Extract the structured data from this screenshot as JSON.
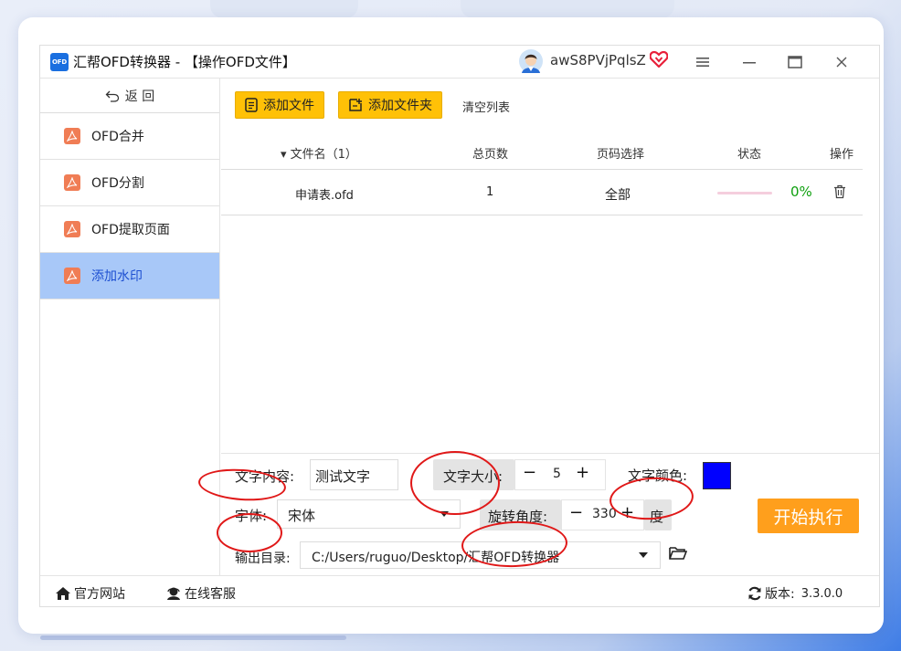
{
  "window": {
    "logo_text": "OFD",
    "title": "汇帮OFD转换器 - 【操作OFD文件】",
    "username": "awS8PVjPqlsZ"
  },
  "sidebar": {
    "back_label": "返  回",
    "items": [
      {
        "label": "OFD合并",
        "active": false
      },
      {
        "label": "OFD分割",
        "active": false
      },
      {
        "label": "OFD提取页面",
        "active": false
      },
      {
        "label": "添加水印",
        "active": true
      }
    ]
  },
  "toolbar": {
    "add_file": "添加文件",
    "add_folder": "添加文件夹",
    "clear_list": "清空列表"
  },
  "table": {
    "headers": {
      "filename": "▾ 文件名（1）",
      "pages": "总页数",
      "page_select": "页码选择",
      "status": "状态",
      "actions": "操作"
    },
    "rows": [
      {
        "filename": "申请表.ofd",
        "pages": "1",
        "page_select": "全部",
        "progress": 0,
        "percent": "0%"
      }
    ]
  },
  "settings": {
    "text_content_label": "文字内容:",
    "text_content_value": "测试文字",
    "font_size_label": "文字大小:",
    "font_size_value": "5",
    "font_color_label": "文字颜色:",
    "font_color": "#0000ff",
    "font_label": "字体:",
    "font_value": "宋体",
    "rotation_label": "旋转角度:",
    "rotation_value": "330",
    "rotation_unit": "度",
    "output_label": "输出目录:",
    "output_value": "C:/Users/ruguo/Desktop/汇帮OFD转换器",
    "minus": "−",
    "plus": "+",
    "start_button": "开始执行"
  },
  "statusbar": {
    "website": "官方网站",
    "support": "在线客服",
    "version_label": "版本:",
    "version": "3.3.0.0"
  },
  "colors": {
    "accent_yellow": "#ffc107",
    "start_orange": "#ff9f1c",
    "active_sidebar": "#a8c8f8",
    "pdf_icon": "#f07d55",
    "annotation_red": "#e01818"
  }
}
